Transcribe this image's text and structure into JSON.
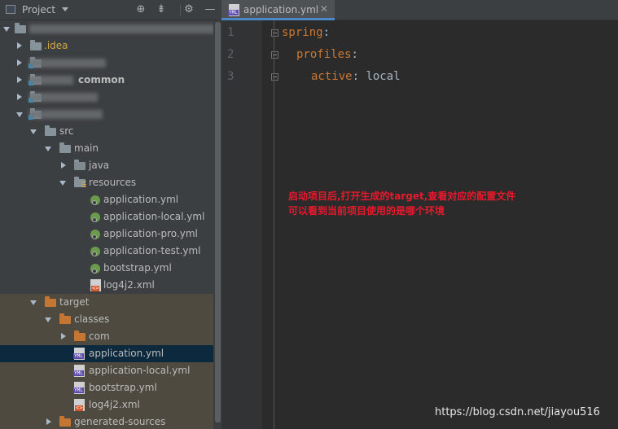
{
  "panel": {
    "title": "Project"
  },
  "tree": {
    "root_label": "",
    "idea": ".idea",
    "common": "common",
    "src": "src",
    "main": "main",
    "java": "java",
    "resources": "resources",
    "res_files": [
      "application.yml",
      "application-local.yml",
      "application-pro.yml",
      "application-test.yml",
      "bootstrap.yml",
      "log4j2.xml"
    ],
    "target": "target",
    "classes": "classes",
    "com": "com",
    "target_files": [
      "application.yml",
      "application-local.yml",
      "bootstrap.yml",
      "log4j2.xml"
    ],
    "generated_sources": "generated-sources"
  },
  "editor": {
    "tab_title": "application.yml",
    "line_numbers": [
      "1",
      "2",
      "3"
    ],
    "lines": [
      {
        "key": "spring",
        "colon": ":",
        "value": ""
      },
      {
        "key": "profiles",
        "colon": ":",
        "value": ""
      },
      {
        "key": "active",
        "colon": ":",
        "value": " local"
      }
    ]
  },
  "annotation": {
    "line1": "启动项目后,打开生成的target,查看对应的配置文件",
    "line2": "可以看到当前项目使用的是哪个环境"
  },
  "watermark": "https://blog.csdn.net/jiayou516",
  "colors": {
    "background": "#2b2b2b",
    "panel": "#3c3f41",
    "key": "#cc7832",
    "annotation": "#e8192c",
    "selection": "#0d293e"
  }
}
